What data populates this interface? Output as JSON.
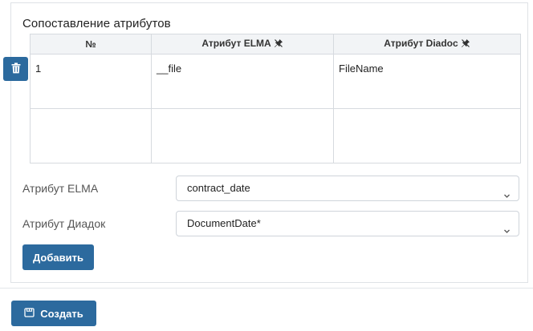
{
  "panel": {
    "title": "Сопоставление атрибутов"
  },
  "table": {
    "headers": {
      "number": "№",
      "elma": "Атрибут ELMA",
      "diadoc": "Атрибут Diadoc"
    },
    "rows": [
      {
        "number": "1",
        "elma": "__file",
        "diadoc": "FileName"
      },
      {
        "number": "",
        "elma": "",
        "diadoc": ""
      }
    ]
  },
  "form": {
    "elma_label": "Атрибут ELMA",
    "elma_value": "contract_date",
    "diadoc_label": "Атрибут Диадок",
    "diadoc_value": "DocumentDate*",
    "add_label": "Добавить"
  },
  "footer": {
    "create_label": "Создать"
  },
  "icons": {
    "delete": "trash-icon",
    "header_pin": "pin-off-icon",
    "select_chevron": "chevron-down-icon",
    "create": "document-save-icon"
  },
  "colors": {
    "primary": "#2c6a9e",
    "border": "#d6dadf",
    "header_bg": "#f2f4f6"
  }
}
